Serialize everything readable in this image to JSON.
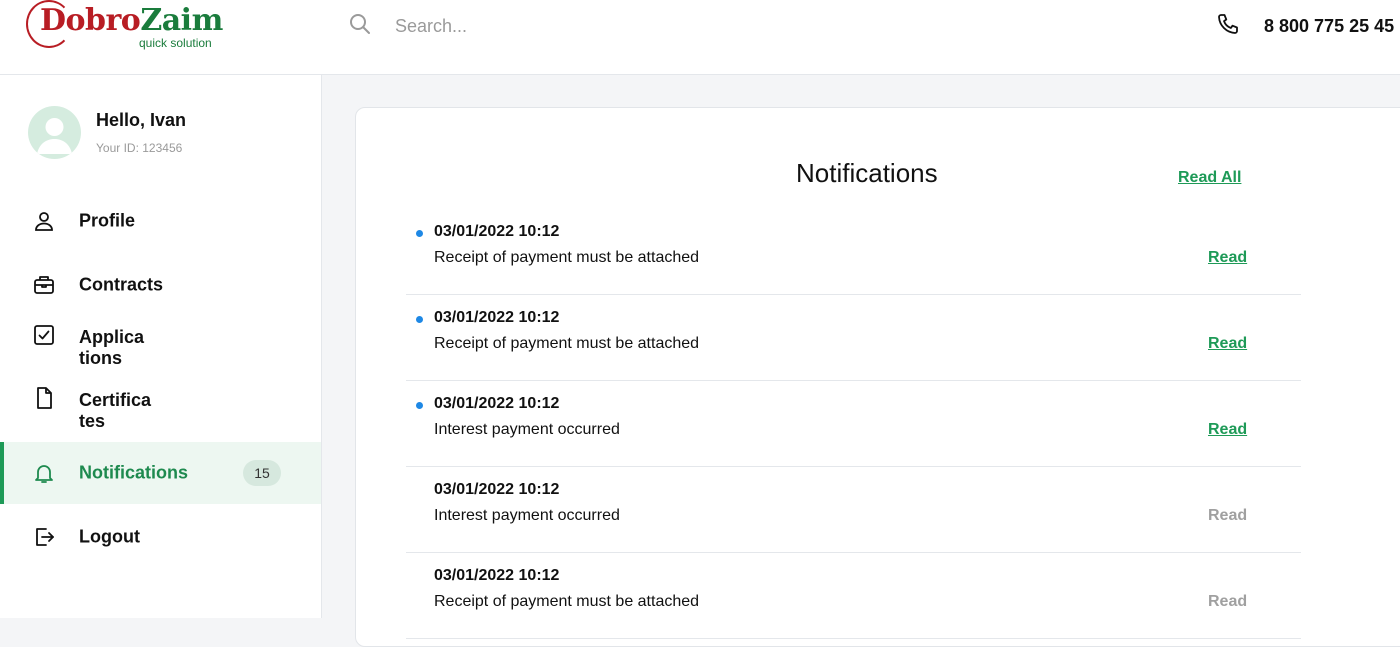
{
  "header": {
    "logo": {
      "part1": "Dobro",
      "part2": "Zaim",
      "tagline": "quick solution"
    },
    "search_placeholder": "Search...",
    "phone": "8 800 775 25 45"
  },
  "user": {
    "greeting": "Hello, Ivan",
    "id_label": "Your ID: 123456"
  },
  "sidebar": {
    "items": [
      {
        "label": "Profile",
        "icon": "person-icon"
      },
      {
        "label": "Contracts",
        "icon": "briefcase-icon"
      },
      {
        "label": "Applica tions",
        "icon": "checkbox-icon"
      },
      {
        "label": "Certifica tes",
        "icon": "document-icon"
      },
      {
        "label": "Notifications",
        "icon": "bell-icon",
        "badge": "15",
        "active": true
      },
      {
        "label": "Logout",
        "icon": "logout-icon"
      }
    ]
  },
  "notifications": {
    "title": "Notifications",
    "read_all": "Read All",
    "items": [
      {
        "date": "03/01/2022 10:12",
        "text": "Receipt of payment must be attached",
        "action": "Read",
        "unread": true
      },
      {
        "date": "03/01/2022 10:12",
        "text": "Receipt of payment must be attached",
        "action": "Read",
        "unread": true
      },
      {
        "date": "03/01/2022 10:12",
        "text": "Interest payment occurred",
        "action": "Read",
        "unread": true
      },
      {
        "date": "03/01/2022 10:12",
        "text": "Interest payment occurred",
        "action": "Read",
        "unread": false
      },
      {
        "date": "03/01/2022 10:12",
        "text": "Receipt of payment must be attached",
        "action": "Read",
        "unread": false
      }
    ]
  },
  "colors": {
    "accent": "#1e9a57",
    "brand_red": "#b81d24",
    "unread_dot": "#1e88e5"
  }
}
